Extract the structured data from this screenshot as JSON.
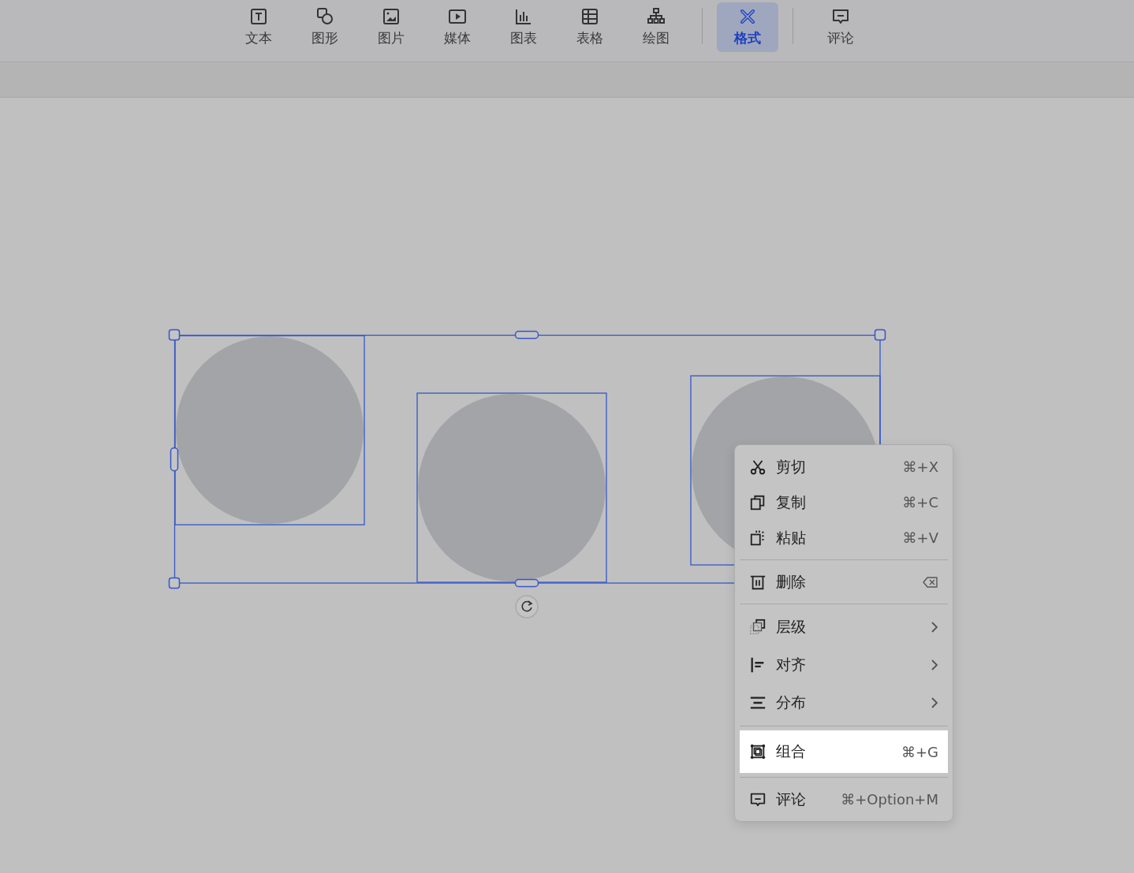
{
  "toolbar": {
    "items": [
      {
        "label": "文本",
        "selected": false
      },
      {
        "label": "图形",
        "selected": false
      },
      {
        "label": "图片",
        "selected": false
      },
      {
        "label": "媒体",
        "selected": false
      },
      {
        "label": "图表",
        "selected": false
      },
      {
        "label": "表格",
        "selected": false
      },
      {
        "label": "绘图",
        "selected": false
      },
      {
        "label": "格式",
        "selected": true
      },
      {
        "label": "评论",
        "selected": false
      }
    ]
  },
  "context_menu": {
    "groups": [
      [
        {
          "label": "剪切",
          "kind": "shortcut",
          "shortcut": "⌘+X",
          "selected": false
        },
        {
          "label": "复制",
          "kind": "shortcut",
          "shortcut": "⌘+C",
          "selected": false
        },
        {
          "label": "粘贴",
          "kind": "shortcut",
          "shortcut": "⌘+V",
          "selected": false
        }
      ],
      [
        {
          "label": "删除",
          "kind": "key_icon",
          "selected": false
        }
      ],
      [
        {
          "label": "层级",
          "kind": "submenu",
          "selected": false
        },
        {
          "label": "对齐",
          "kind": "submenu",
          "selected": false
        },
        {
          "label": "分布",
          "kind": "submenu",
          "selected": false
        }
      ],
      [
        {
          "label": "组合",
          "kind": "shortcut",
          "shortcut": "⌘+G",
          "selected": true
        }
      ],
      [
        {
          "label": "评论",
          "kind": "shortcut",
          "shortcut": "⌘+Option+M",
          "selected": false
        }
      ]
    ]
  }
}
